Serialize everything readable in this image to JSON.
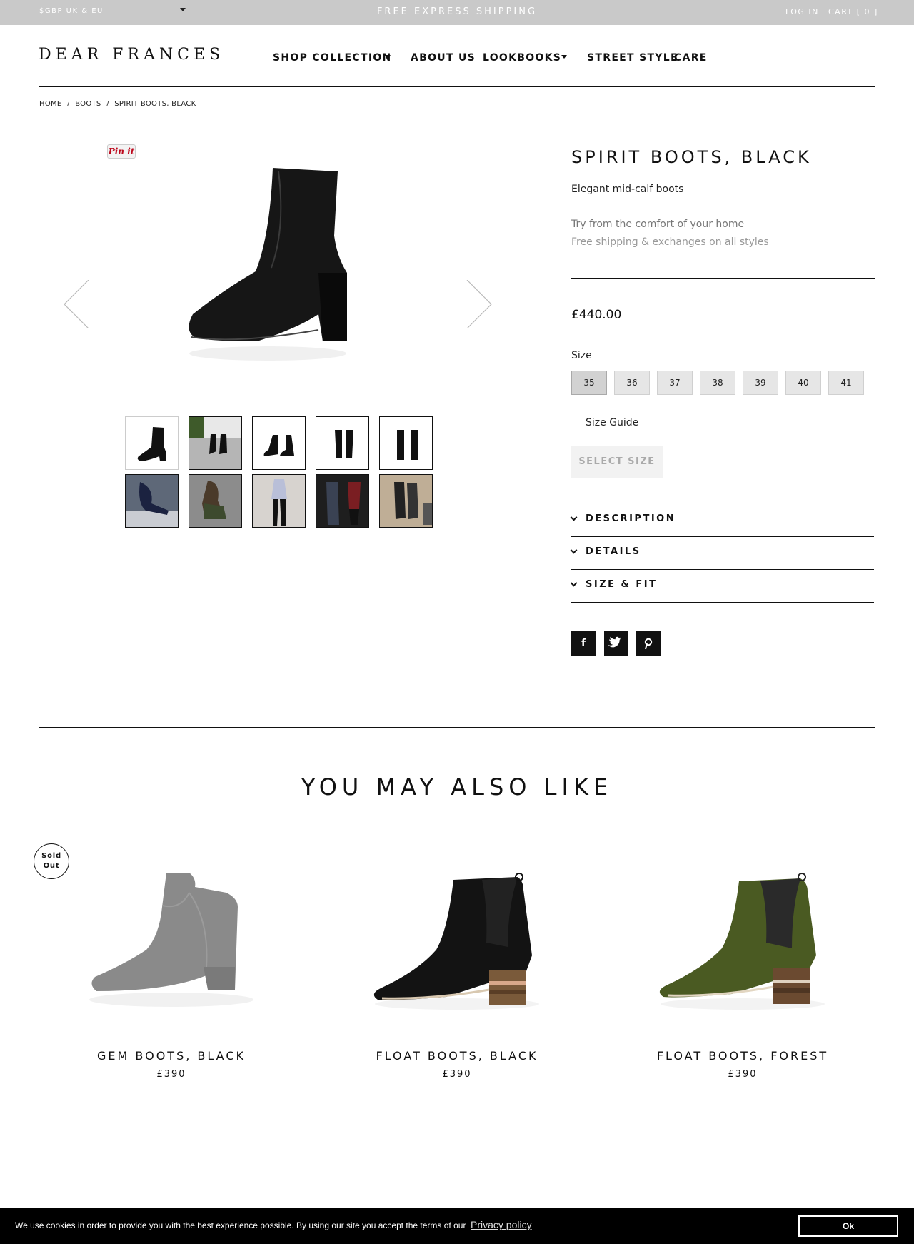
{
  "topbar": {
    "currency": "$GBP  UK & EU",
    "promo": "FREE EXPRESS SHIPPING",
    "login": "LOG IN",
    "cart": "CART [ 0 ]"
  },
  "header": {
    "logo": "DEAR FRANCES",
    "nav": [
      "SHOP COLLECTION",
      "ABOUT US",
      "LOOKBOOKS",
      "STREET STYLE",
      "CARE"
    ]
  },
  "breadcrumb": [
    "HOME",
    "/",
    "BOOTS",
    "/",
    "SPIRIT BOOTS, BLACK"
  ],
  "gallery": {
    "pin_label": "Pin it"
  },
  "product": {
    "title": "SPIRIT BOOTS, BLACK",
    "subtitle": "Elegant mid-calf boots",
    "try_home": "Try from the comfort of your home",
    "free_shipping": "Free shipping & exchanges on all styles",
    "price": "£440.00",
    "size_label": "Size",
    "sizes": [
      "35",
      "36",
      "37",
      "38",
      "39",
      "40",
      "41"
    ],
    "selected_size": "35",
    "size_guide": "Size Guide",
    "select_size_button": "SELECT SIZE",
    "accordion": [
      "DESCRIPTION",
      "DETAILS",
      "SIZE & FIT"
    ],
    "share": [
      "f",
      "t",
      "p"
    ]
  },
  "recommendations": {
    "heading": "YOU MAY ALSO LIKE",
    "sold_out_badge": "Sold Out",
    "items": [
      {
        "name": "GEM BOOTS, BLACK",
        "price": "£390"
      },
      {
        "name": "FLOAT BOOTS, BLACK",
        "price": "£390"
      },
      {
        "name": "FLOAT BOOTS, FOREST",
        "price": "£390"
      }
    ]
  },
  "cookie": {
    "text": "We use cookies in order to provide you with the best experience possible. By using our site you accept the terms of our",
    "link": "Privacy policy",
    "ok": "Ok"
  },
  "colors": {
    "topbar_bg": "#c9c9c9",
    "text": "#111111",
    "boot_green": "#4a5a22",
    "cookie_bg": "#000000"
  }
}
